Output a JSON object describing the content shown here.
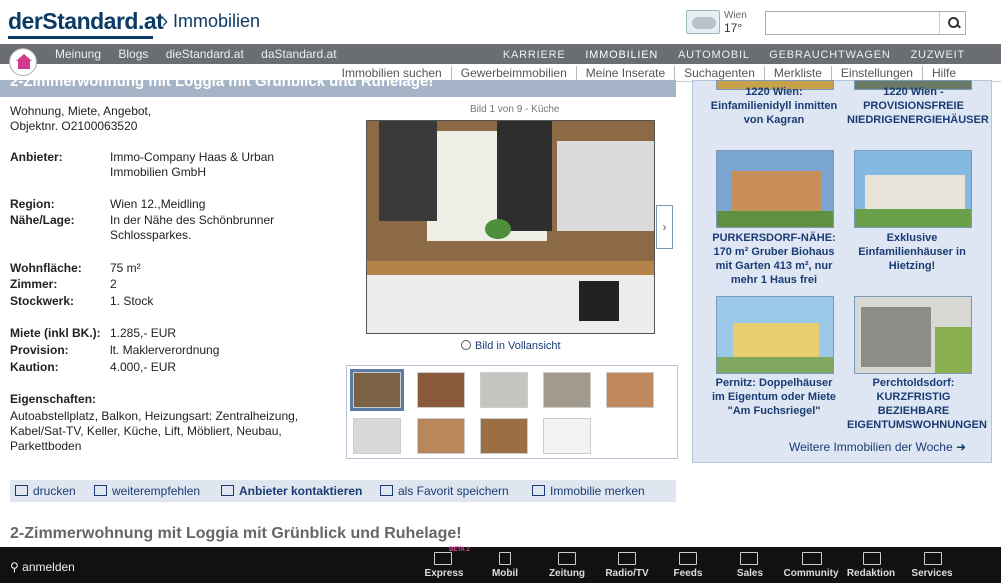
{
  "header": {
    "logo": "derStandard.at",
    "section": "› Immobilien",
    "weather_city": "Wien",
    "weather_temp": "17°",
    "search_placeholder": ""
  },
  "nav_left": [
    "Meinung",
    "Blogs",
    "dieStandard.at",
    "daStandard.at"
  ],
  "nav_right": [
    "KARRIERE",
    "IMMOBILIEN",
    "AUTOMOBIL",
    "GEBRAUCHTWAGEN",
    "ZUZWEIT"
  ],
  "subnav": [
    "Immobilien suchen",
    "Gewerbeimmobilien",
    "Meine Inserate",
    "Suchagenten",
    "Merkliste",
    "Einstellungen",
    "Hilfe"
  ],
  "listing": {
    "title": "2-Zimmerwohnung mit Loggia mit Grünblick und Ruhelage!",
    "type_line": "Wohnung, Miete, Angebot,",
    "objekt": "Objektnr. O2100063520",
    "anbieter_label": "Anbieter:",
    "anbieter": "Immo-Company Haas & Urban Immobilien GmbH",
    "region_label": "Region:",
    "region": "Wien 12.,Meidling",
    "lage_label": "Nähe/Lage:",
    "lage": "In der Nähe des Schönbrunner Schlossparkes.",
    "wohnflaeche_label": "Wohnfläche:",
    "wohnflaeche": "75 m²",
    "zimmer_label": "Zimmer:",
    "zimmer": "2",
    "stockwerk_label": "Stockwerk:",
    "stockwerk": "1. Stock",
    "miete_label": "Miete (inkl BK.):",
    "miete": "1.285,- EUR",
    "provision_label": "Provision:",
    "provision": "lt. Maklerverordnung",
    "kaution_label": "Kaution:",
    "kaution": "4.000,- EUR",
    "eigenschaften_label": "Eigenschaften:",
    "eigenschaften": "Autoabstellplatz, Balkon, Heizungsart: Zentralheizung, Kabel/Sat-TV, Keller, Küche, Lift, Möbliert, Neubau, Parkettboden",
    "bild_count": "Bild 1 von 9 - Küche",
    "fullview": "Bild in Vollansicht"
  },
  "actions": {
    "print": "drucken",
    "recommend": "weiterempfehlen",
    "contact": "Anbieter kontaktieren",
    "favorite": "als Favorit speichern",
    "remember": "Immobilie merken"
  },
  "bottom_title": "2-Zimmerwohnung mit Loggia mit Grünblick und Ruhelage!",
  "right_panel": {
    "cap1": "1220 Wien: Einfamilienidyll inmitten von Kagran",
    "cap2": "1220 Wien - PROVISIONSFREIE NIEDRIGENERGIEHÄUSER",
    "cap3": "PURKERSDORF-NÄHE: 170 m² Gruber Biohaus mit Garten 413 m², nur mehr 1 Haus frei",
    "cap4": "Exklusive Einfamilienhäuser in Hietzing!",
    "cap5": "Pernitz: Doppelhäuser im Eigentum oder Miete \"Am Fuchsriegel\"",
    "cap6": "Perchtoldsdorf: KURZFRISTIG BEZIEHBARE EIGENTUMSWOHNUNGEN",
    "more": "Weitere Immobilien der Woche"
  },
  "bottom_bar": {
    "login": "anmelden",
    "beta": "BETA 2",
    "items": [
      "Express",
      "Mobil",
      "Zeitung",
      "Radio/TV",
      "Feeds",
      "Sales",
      "Community",
      "Redaktion",
      "Services"
    ]
  }
}
